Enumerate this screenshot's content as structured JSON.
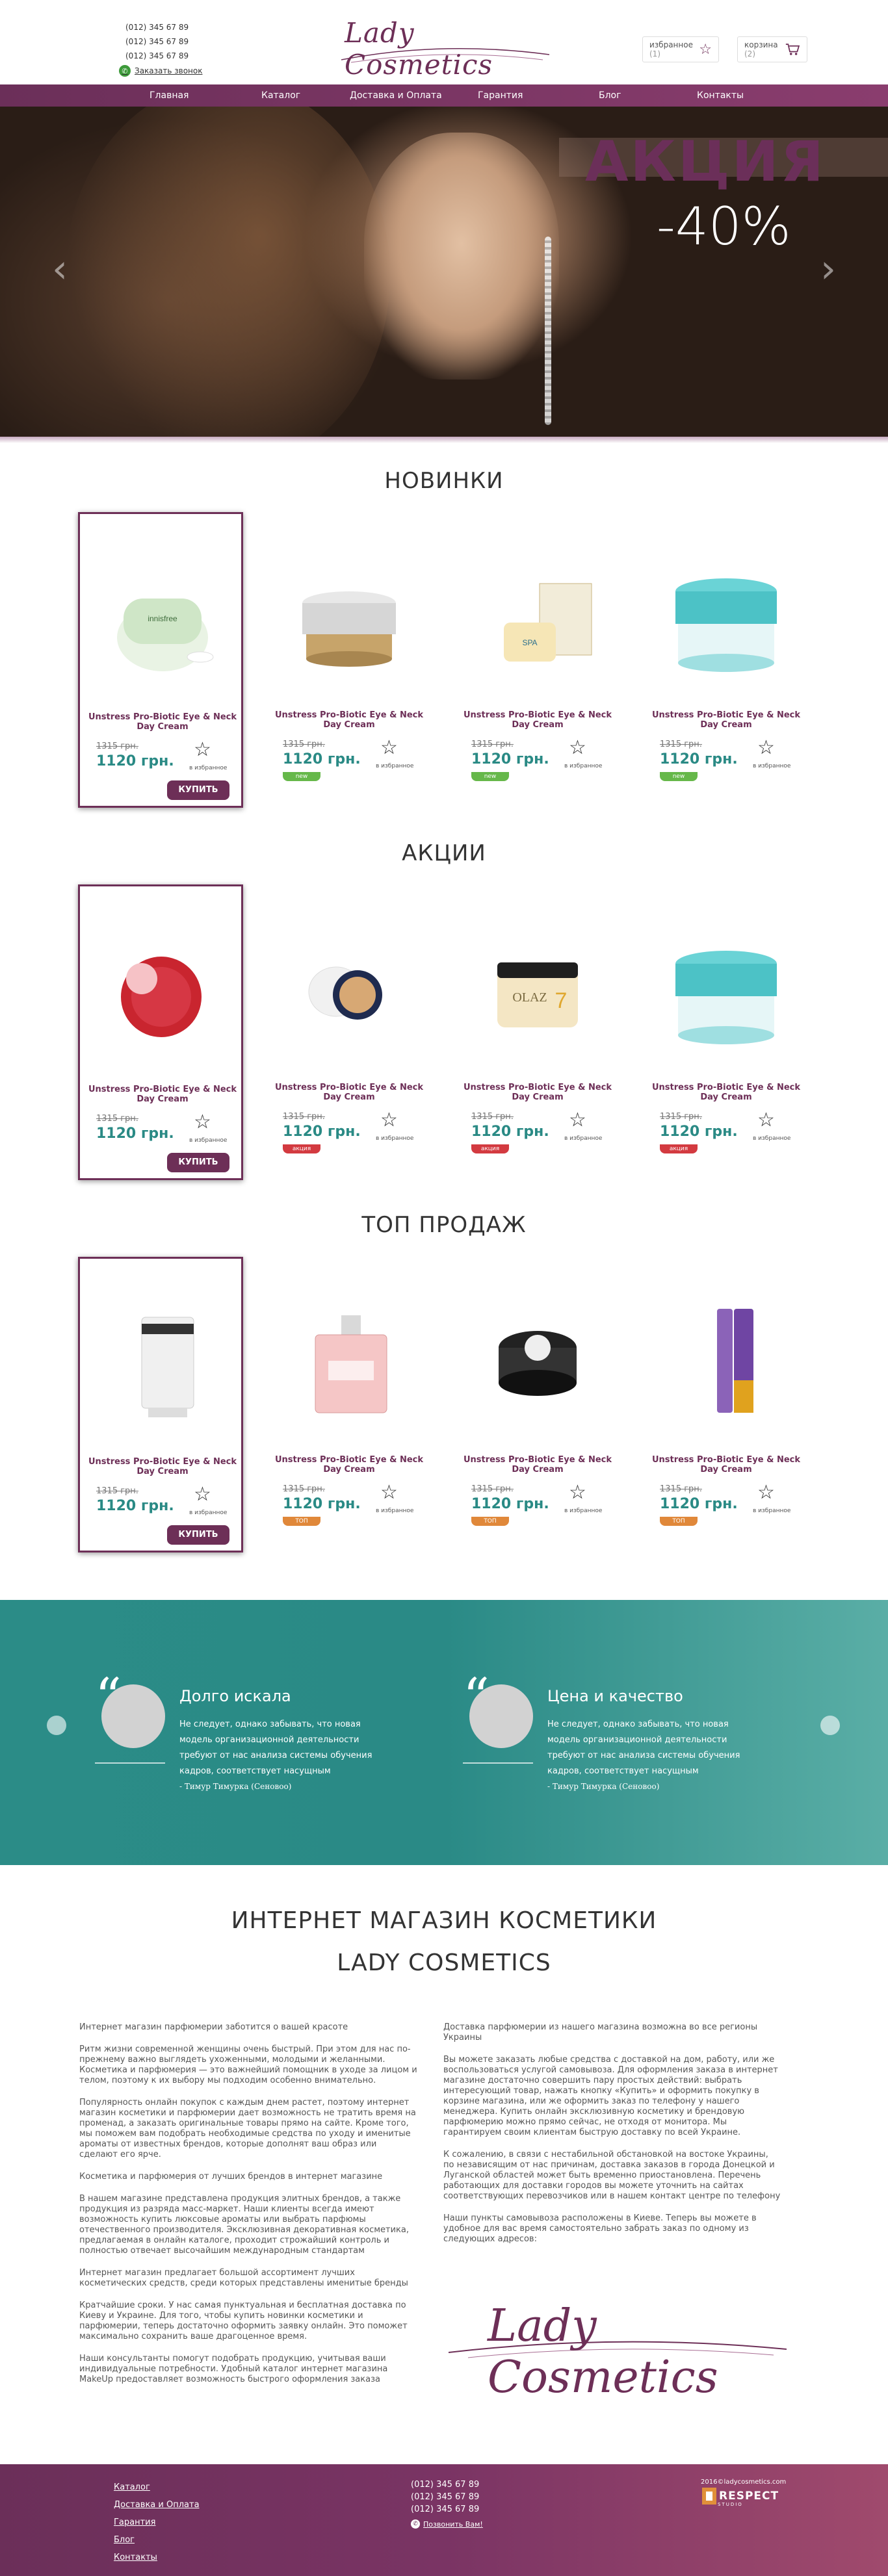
{
  "header": {
    "phones": [
      "(012) 345 67 89",
      "(012) 345 67 89",
      "(012) 345 67 89"
    ],
    "callback_label": "Заказать звонок",
    "logo": "Lady Cosmetics",
    "favorites": {
      "label": "избранное",
      "count": "(1)"
    },
    "cart": {
      "label": "корзина",
      "count": "(2)"
    }
  },
  "nav": {
    "items": [
      "Главная",
      "Каталог",
      "Доставка и Оплата",
      "Гарантия",
      "Блог",
      "Контакты"
    ]
  },
  "hero": {
    "title": "АКЦИЯ",
    "discount": "-40%"
  },
  "sections": [
    {
      "title": "НОВИНКИ",
      "products": [
        {
          "name": "Unstress Pro-Biotic Eye & Neck Day Cream",
          "old_price": "1315 грн.",
          "price": "1120 грн.",
          "fav": "в избранное",
          "badge": "",
          "buy": "КУПИТЬ"
        },
        {
          "name": "Unstress Pro-Biotic Eye & Neck Day Cream",
          "old_price": "1315 грн.",
          "price": "1120 грн.",
          "fav": "в избранное",
          "badge": "new",
          "buy": ""
        },
        {
          "name": "Unstress Pro-Biotic Eye & Neck Day Cream",
          "old_price": "1315 грн.",
          "price": "1120 грн.",
          "fav": "в избранное",
          "badge": "new",
          "buy": ""
        },
        {
          "name": "Unstress Pro-Biotic Eye & Neck Day Cream",
          "old_price": "1315 грн.",
          "price": "1120 грн.",
          "fav": "в избранное",
          "badge": "new",
          "buy": ""
        }
      ]
    },
    {
      "title": "АКЦИИ",
      "products": [
        {
          "name": "Unstress Pro-Biotic Eye & Neck Day Cream",
          "old_price": "1315 грн.",
          "price": "1120 грн.",
          "fav": "в избранное",
          "badge": "",
          "buy": "КУПИТЬ"
        },
        {
          "name": "Unstress Pro-Biotic Eye & Neck Day Cream",
          "old_price": "1315 грн.",
          "price": "1120 грн.",
          "fav": "в избранное",
          "badge": "акция",
          "buy": ""
        },
        {
          "name": "Unstress Pro-Biotic Eye & Neck Day Cream",
          "old_price": "1315 грн.",
          "price": "1120 грн.",
          "fav": "в избранное",
          "badge": "акция",
          "buy": ""
        },
        {
          "name": "Unstress Pro-Biotic Eye & Neck Day Cream",
          "old_price": "1315 грн.",
          "price": "1120 грн.",
          "fav": "в избранное",
          "badge": "акция",
          "buy": ""
        }
      ]
    },
    {
      "title": "ТОП ПРОДАЖ",
      "products": [
        {
          "name": "Unstress Pro-Biotic Eye & Neck Day Cream",
          "old_price": "1315 грн.",
          "price": "1120 грн.",
          "fav": "в избранное",
          "badge": "",
          "buy": "КУПИТЬ"
        },
        {
          "name": "Unstress Pro-Biotic Eye & Neck Day Cream",
          "old_price": "1315 грн.",
          "price": "1120 грн.",
          "fav": "в избранное",
          "badge": "ТОП",
          "buy": ""
        },
        {
          "name": "Unstress Pro-Biotic Eye & Neck Day Cream",
          "old_price": "1315 грн.",
          "price": "1120 грн.",
          "fav": "в избранное",
          "badge": "ТОП",
          "buy": ""
        },
        {
          "name": "Unstress Pro-Biotic Eye & Neck Day Cream",
          "old_price": "1315 грн.",
          "price": "1120 грн.",
          "fav": "в избранное",
          "badge": "ТОП",
          "buy": ""
        }
      ]
    }
  ],
  "reviews": [
    {
      "title": "Долго искала",
      "text": "Не следует, однако забывать, что новая модель организационной деятельности требуют от нас анализа системы обучения кадров, соответствует насущным",
      "author": "- Тимур Тимурка (Сеновоо)"
    },
    {
      "title": "Цена и качество",
      "text": "Не следует, однако забывать, что новая модель организационной деятельности требуют от нас анализа системы обучения кадров, соответствует насущным",
      "author": "- Тимур Тимурка (Сеновоо)"
    }
  ],
  "about": {
    "title_line1": "ИНТЕРНЕТ МАГАЗИН КОСМЕТИКИ",
    "title_line2": "LADY COSMETICS",
    "left": [
      "Интернет магазин парфюмерии заботится о вашей красоте",
      "Ритм жизни современной женщины очень быстрый. При этом для нас по-прежнему важно выглядеть ухоженными, молодыми и желанными. Косметика и парфюмерия — это важнейший помощник в уходе за лицом и телом, поэтому к их выбору мы подходим особенно внимательно.",
      "Популярность онлайн покупок с каждым днем растет, поэтому интернет магазин косметики и парфюмерии дает возможность не тратить время на променад, а заказать оригинальные товары прямо на сайте. Кроме того, мы поможем вам подобрать необходимые средства по уходу и именитые ароматы от известных брендов, которые дополнят ваш образ или сделают его ярче.",
      "Косметика и парфюмерия от лучших брендов в интернет магазине",
      "В нашем магазине представлена продукция элитных брендов, а также продукция из разряда масс-маркет. Наши клиенты всегда имеют возможность купить люксовые ароматы или выбрать парфюмы отечественного производителя. Эксклюзивная декоративная косметика, предлагаемая в онлайн каталоге, проходит строжайший контроль и полностью отвечает высочайшим международным стандартам",
      "Интернет магазин предлагает большой ассортимент лучших косметических средств, среди которых представлены именитые бренды",
      "Кратчайшие сроки. У нас самая пунктуальная и бесплатная доставка по Киеву и Украине. Для того, чтобы купить новинки косметики и парфюмерии, теперь достаточно оформить заявку онлайн. Это поможет максимально сохранить ваше драгоценное время.",
      "Наши консультанты помогут подобрать продукцию, учитывая ваши индивидуальные потребности. Удобный каталог интернет магазина MakeUp предоставляет возможность быстрого оформления заказа"
    ],
    "right": [
      "Доставка парфюмерии из нашего магазина возможна во все регионы Украины",
      "Вы можете заказать любые средства с доставкой на дом, работу, или же воспользоваться услугой самовывоза. Для оформления заказа в интернет магазине достаточно совершить пару простых действий: выбрать интересующий товар, нажать кнопку «Купить» и оформить покупку в корзине магазина, или же оформить заказ по телефону у нашего менеджера. Купить онлайн эксклюзивную косметику и брендовую парфюмерию можно прямо сейчас, не отходя от монитора. Мы гарантируем своим клиентам быструю доставку по всей Украине.",
      "К сожалению, в связи с нестабильной обстановкой на востоке Украины, по независящим от нас причинам, доставка заказов в города Донецкой и Луганской областей может быть временно приостановлена. Перечень работающих для доставки городов вы можете уточнить на сайтах соответствующих перевозчиков или в нашем контакт центре по телефону",
      "Наши пункты самовывоза расположены в Киеве. Теперь вы можете в удобное для вас время самостоятельно забрать заказ по одному из следующих адресов:"
    ],
    "logo": "Lady Cosmetics"
  },
  "footer": {
    "links": [
      "Каталог",
      "Доставка и Оплата",
      "Гарантия",
      "Блог",
      "Контакты"
    ],
    "phones": [
      "(012) 345 67 89",
      "(012) 345 67 89",
      "(012) 345 67 89"
    ],
    "callback_label": "Позвонить Вам!",
    "copyright": "2016©ladycosmetics.com",
    "dev_brand": "RESPECT",
    "dev_sub": "STUDIO"
  },
  "colors": {
    "brand": "#6d2f57",
    "price": "#2a8a85",
    "teal": "#2b8c87",
    "new": "#66b84a",
    "sale": "#d33a40",
    "top": "#e0883a"
  }
}
